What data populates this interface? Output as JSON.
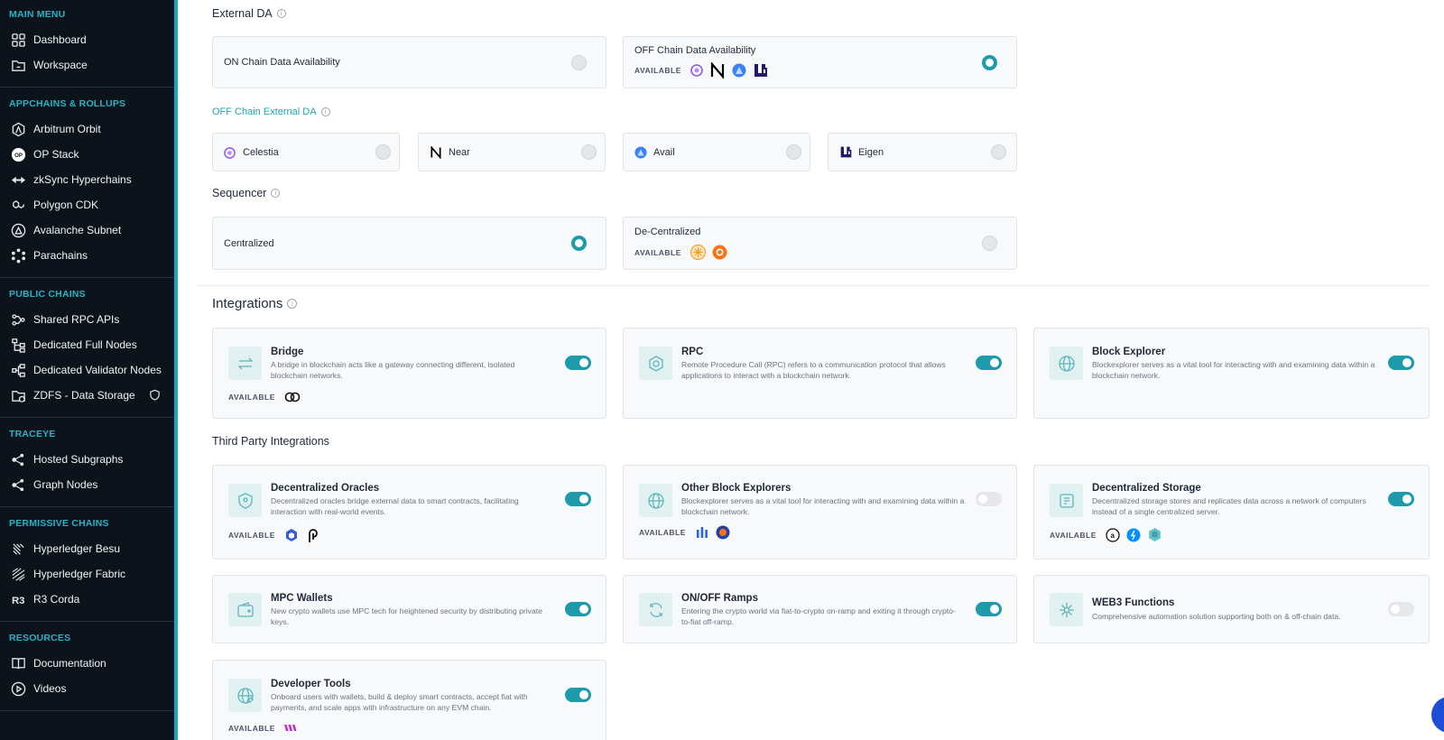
{
  "sidebar": {
    "sections": [
      {
        "heading": "MAIN MENU",
        "items": [
          {
            "label": "Dashboard",
            "icon": "grid-icon"
          },
          {
            "label": "Workspace",
            "icon": "folder-icon"
          }
        ]
      },
      {
        "heading": "APPCHAINS & ROLLUPS",
        "items": [
          {
            "label": "Arbitrum Orbit",
            "icon": "arbitrum-icon"
          },
          {
            "label": "OP Stack",
            "icon": "op-icon"
          },
          {
            "label": "zkSync Hyperchains",
            "icon": "zksync-icon"
          },
          {
            "label": "Polygon CDK",
            "icon": "polygon-icon"
          },
          {
            "label": "Avalanche Subnet",
            "icon": "avalanche-icon"
          },
          {
            "label": "Parachains",
            "icon": "parachain-icon"
          }
        ]
      },
      {
        "heading": "PUBLIC CHAINS",
        "items": [
          {
            "label": "Shared RPC APIs",
            "icon": "rpc-icon"
          },
          {
            "label": "Dedicated Full Nodes",
            "icon": "nodes-icon"
          },
          {
            "label": "Dedicated Validator Nodes",
            "icon": "validator-icon"
          },
          {
            "label": "ZDFS - Data Storage",
            "icon": "storage-icon"
          }
        ]
      },
      {
        "heading": "TRACEYE",
        "items": [
          {
            "label": "Hosted Subgraphs",
            "icon": "subgraph-icon"
          },
          {
            "label": "Graph Nodes",
            "icon": "graph-node-icon"
          }
        ]
      },
      {
        "heading": "PERMISSIVE CHAINS",
        "items": [
          {
            "label": "Hyperledger Besu",
            "icon": "besu-icon"
          },
          {
            "label": "Hyperledger Fabric",
            "icon": "fabric-icon"
          },
          {
            "label": "R3 Corda",
            "icon": "corda-icon"
          }
        ]
      },
      {
        "heading": "RESOURCES",
        "items": [
          {
            "label": "Documentation",
            "icon": "book-icon"
          },
          {
            "label": "Videos",
            "icon": "play-icon"
          }
        ]
      }
    ]
  },
  "external_da": {
    "title": "External DA",
    "on_chain": {
      "label": "ON Chain Data Availability",
      "selected": false
    },
    "off_chain": {
      "label": "OFF Chain Data Availability",
      "selected": true,
      "available_label": "AVAILABLE",
      "logos": [
        "celestia-logo",
        "near-logo",
        "avail-logo",
        "eigen-logo"
      ]
    }
  },
  "off_chain_external_da": {
    "title": "OFF Chain External DA",
    "options": [
      {
        "label": "Celestia",
        "icon": "celestia-logo"
      },
      {
        "label": "Near",
        "icon": "near-logo"
      },
      {
        "label": "Avail",
        "icon": "avail-logo"
      },
      {
        "label": "Eigen",
        "icon": "eigen-logo"
      }
    ]
  },
  "sequencer": {
    "title": "Sequencer",
    "centralized": {
      "label": "Centralized",
      "selected": true
    },
    "decentralized": {
      "label": "De-Centralized",
      "selected": false,
      "available_label": "AVAILABLE",
      "logos": [
        "espresso-logo",
        "astria-logo"
      ]
    }
  },
  "integrations": {
    "title": "Integrations",
    "items": [
      {
        "title": "Bridge",
        "desc": "A bridge in blockchain acts like a gateway connecting different, isolated blockchain networks.",
        "enabled": true,
        "available_label": "AVAILABLE",
        "icon": "bridge-icon"
      },
      {
        "title": "RPC",
        "desc": "Remote Procedure Call (RPC) refers to a communication protocol that allows applications to interact with a blockchain network.",
        "enabled": true,
        "icon": "rpc-icon"
      },
      {
        "title": "Block Explorer",
        "desc": "Blockexplorer serves as a vital tool for interacting with and examining data within a blockchain network.",
        "enabled": true,
        "icon": "globe-icon"
      }
    ]
  },
  "third_party": {
    "title": "Third Party Integrations",
    "items": [
      {
        "title": "Decentralized Oracles",
        "desc": "Decentralized oracles bridge external data to smart contracts, facilitating interaction with real-world events.",
        "enabled": true,
        "available_label": "AVAILABLE",
        "icon": "oracle-icon"
      },
      {
        "title": "Other Block Explorers",
        "desc": "Blockexplorer serves as a vital tool for interacting with and examining data within a blockchain network.",
        "enabled": false,
        "available_label": "AVAILABLE",
        "icon": "globe-icon"
      },
      {
        "title": "Decentralized Storage",
        "desc": "Decentralized storage stores and replicates data across a network of computers instead of a single centralized server.",
        "enabled": true,
        "available_label": "AVAILABLE",
        "icon": "storage-icon"
      },
      {
        "title": "MPC Wallets",
        "desc": "New crypto wallets use MPC tech for heightened security by distributing private keys.",
        "enabled": true,
        "icon": "wallet-icon"
      },
      {
        "title": "ON/OFF Ramps",
        "desc": "Entering the crypto world via fiat-to-crypto on-ramp and exiting it through crypto-to-fiat off-ramp.",
        "enabled": true,
        "icon": "ramp-icon"
      },
      {
        "title": "WEB3 Functions",
        "desc": "Comprehensive automation solution supporting both on & off-chain data.",
        "enabled": false,
        "icon": "functions-icon"
      },
      {
        "title": "Developer Tools",
        "desc": "Onboard users with wallets, build & deploy smart contracts, accept fiat with payments, and scale apps with infrastructure on any EVM chain.",
        "enabled": true,
        "available_label": "AVAILABLE",
        "icon": "devtools-icon"
      }
    ]
  },
  "colors": {
    "accent": "#1d9bab",
    "sidebar_bg": "#0d131a",
    "sidebar_heading": "#27b3c8"
  }
}
